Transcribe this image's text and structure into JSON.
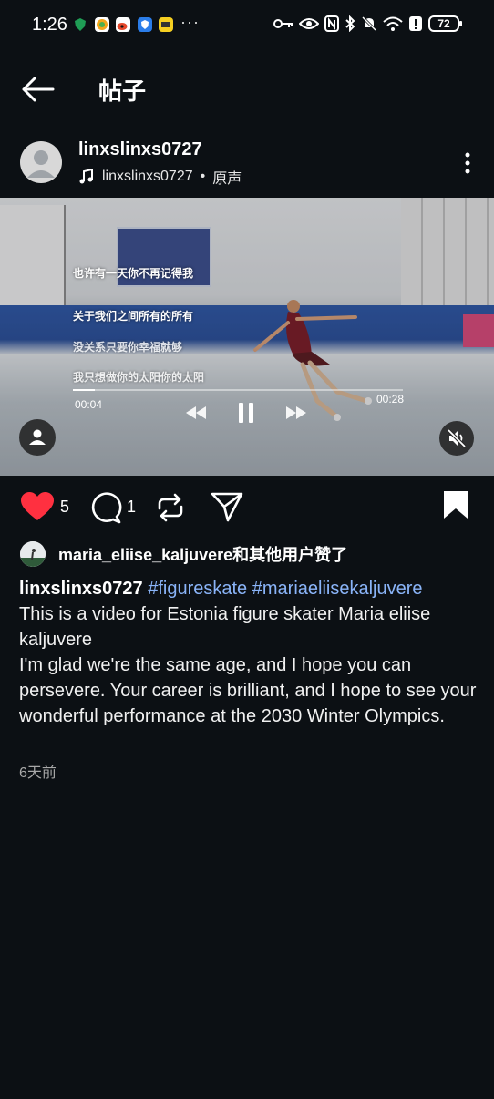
{
  "status_bar": {
    "time": "1:26",
    "more": "···",
    "battery": "72",
    "app_icons": [
      {
        "name": "shield-app-icon",
        "color": "#1f9d55"
      },
      {
        "name": "colorful-app-icon",
        "color": "#f3a51b"
      },
      {
        "name": "weibo-icon",
        "color": "#e5472b"
      },
      {
        "name": "blue-shield-app-icon",
        "color": "#2b7de9"
      },
      {
        "name": "yellow-app-icon",
        "color": "#f6cf21"
      }
    ],
    "right_icons": [
      "key-icon",
      "eye-icon",
      "nfc-icon",
      "bluetooth-icon",
      "mute-icon",
      "wifi-icon",
      "alert-icon"
    ]
  },
  "header": {
    "title": "帖子",
    "back_icon": "arrow-left-icon"
  },
  "post": {
    "username": "linxslinxs0727",
    "audio_user": "linxslinxs0727",
    "audio_separator": "•",
    "audio_label": "原声",
    "more_icon": "vertical-dots-icon"
  },
  "video": {
    "lyrics": [
      "也许有一天你不再记得我",
      "关于我们之间所有的所有",
      "没关系只要你幸福就够",
      "我只想做你的太阳你的太阳"
    ],
    "current_time": "00:04",
    "duration": "00:28",
    "progress": 0.065,
    "state": "playing"
  },
  "actions": {
    "likes": "5",
    "comments": "1",
    "heart_color": "#ff3040"
  },
  "liked_by": {
    "text": "maria_eliise_kaljuvere和其他用户赞了"
  },
  "caption": {
    "user": "linxslinxs0727",
    "tags": [
      "#figureskate",
      "#mariaeliisekaljuvere"
    ],
    "line1": "This is a video for Estonia figure skater Maria eliise kaljuvere",
    "line2": "I'm glad we're the same age, and I hope you can persevere. Your career is brilliant, and I hope to see your wonderful performance at the 2030 Winter Olympics.",
    "time_ago": "6天前"
  }
}
